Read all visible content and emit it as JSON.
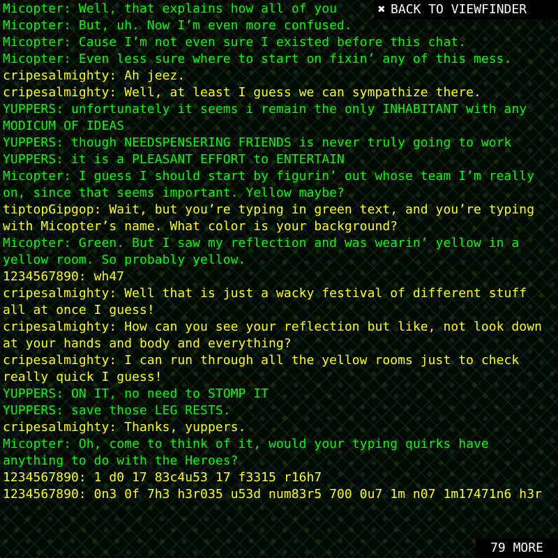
{
  "colors": {
    "green": "#00ff00",
    "yellow": "#ffff00",
    "white": "#ffffff",
    "background": "#030a03"
  },
  "back_button": {
    "icon": "x-close-icon",
    "label": "BACK TO VIEWFINDER"
  },
  "more_button": {
    "label": "79 MORE"
  },
  "messages": [
    {
      "color": "#00ff00",
      "text": "Micopter: Well, that explains how all of you"
    },
    {
      "color": "#00ff00",
      "text": "Micopter: But, uh. Now I’m even more confused."
    },
    {
      "color": "#00ff00",
      "text": "Micopter: Cause I’m not even sure I existed before this chat."
    },
    {
      "color": "#00ff00",
      "text": "Micopter: Even less sure where to start on fixin’ any of this mess."
    },
    {
      "color": "#ffff00",
      "text": "cripesalmighty: Ah jeez."
    },
    {
      "color": "#ffff00",
      "text": "cripesalmighty: Well, at least I guess we can sympathize there."
    },
    {
      "color": "#00ff00",
      "text": "YUPPERS: unfortunately it seems i remain the only INHABITANT with any MODICUM OF IDEAS"
    },
    {
      "color": "#00ff00",
      "text": "YUPPERS: though NEEDSPENSERING FRIENDS is never truly going to work"
    },
    {
      "color": "#00ff00",
      "text": "YUPPERS: it is a PLEASANT EFFORT to ENTERTAIN"
    },
    {
      "color": "#00ff00",
      "text": "Micopter: I guess I should start by figurin’ out whose team I’m really on, since that seems important. Yellow maybe?"
    },
    {
      "color": "#ffff00",
      "text": "tiptopGipgop: Wait, but you’re typing in green text, and you’re typing with Micopter’s name. What color is your background?"
    },
    {
      "color": "#00ff00",
      "text": "Micopter: Green. But I saw my reflection and was wearin’ yellow in a yellow room. So probably yellow."
    },
    {
      "color": "#ffff00",
      "text": "1234567890: wh47"
    },
    {
      "color": "#ffff00",
      "text": "cripesalmighty: Well that is just a wacky festival of different stuff all at once I guess!"
    },
    {
      "color": "#ffff00",
      "text": "cripesalmighty: How can you see your reflection but like, not look down at your hands and body and everything?"
    },
    {
      "color": "#ffff00",
      "text": "cripesalmighty: I can run through all the yellow rooms just to check really quick I guess!"
    },
    {
      "color": "#00ff00",
      "text": "YUPPERS: ON IT, no need to STOMP IT"
    },
    {
      "color": "#00ff00",
      "text": "YUPPERS: save those LEG RESTS."
    },
    {
      "color": "#ffff00",
      "text": "cripesalmighty: Thanks, yuppers."
    },
    {
      "color": "#00ff00",
      "text": "Micopter: Oh, come to think of it, would your typing quirks have anything to do with the Heroes?"
    },
    {
      "color": "#ffff00",
      "text": "1234567890: 1 d0 17 83c4u53 17 f3315 r16h7"
    },
    {
      "color": "#ffff00",
      "text": "1234567890: 0n3 0f 7h3 h3r035 u53d num83r5 700 0u7 1m n07 1m17471n6 h3r"
    }
  ]
}
